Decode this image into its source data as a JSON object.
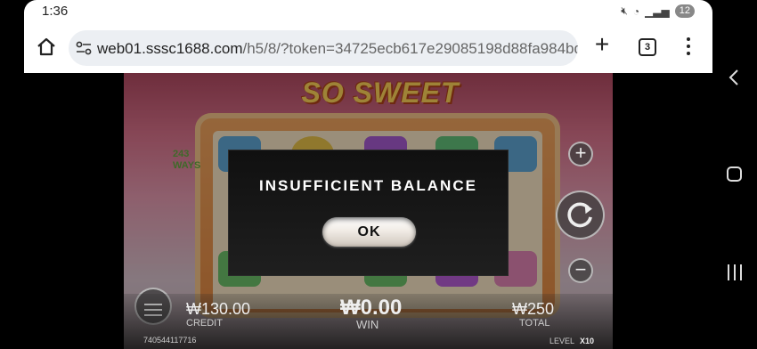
{
  "statusbar": {
    "time": "1:36",
    "notification_count": "12"
  },
  "browser": {
    "url_main": "web01.sssc1688.com",
    "url_rest": "/h5/8/?token=34725ecb617e29085198d88fa984bd9",
    "tab_count": "3",
    "icons": [
      "home-icon",
      "site-settings-icon",
      "new-tab-icon",
      "tabs-icon",
      "more-menu-icon"
    ]
  },
  "game": {
    "logo_text": "SO SWEET",
    "ways_text": "243 WAYS",
    "credit_value": "₩130.00",
    "credit_label": "CREDIT",
    "win_value": "₩0.00",
    "win_label": "WIN",
    "total_value": "₩250",
    "total_label": "TOTAL",
    "game_id": "740544117716",
    "level_label": "LEVEL",
    "level_value": "X10"
  },
  "dialog": {
    "title": "INSUFFICIENT BALANCE",
    "ok_label": "OK"
  },
  "colors": {
    "dialog_bg": "#141414",
    "ok_button": "#f1ece6",
    "toolbar_bg": "#ffffff",
    "urlbar_bg": "#eceff3"
  }
}
